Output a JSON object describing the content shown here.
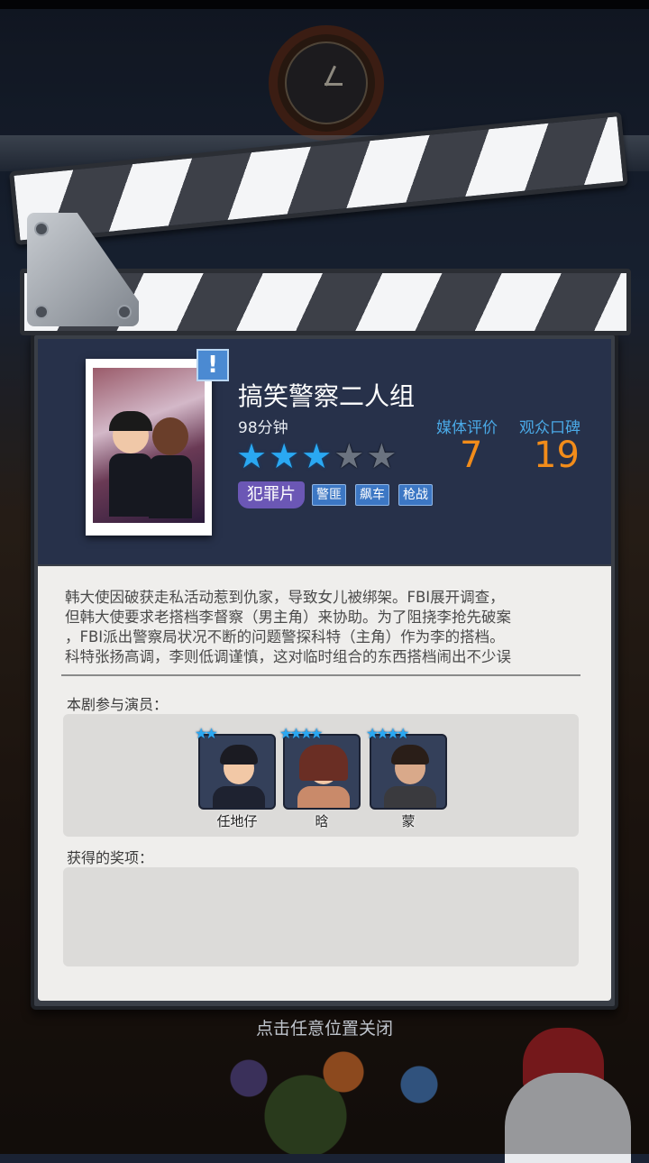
{
  "movie": {
    "title": "搞笑警察二人组",
    "duration": "98分钟",
    "rating_stars": 3,
    "max_stars": 5,
    "genre": "犯罪片",
    "tags": [
      "警匪",
      "飙车",
      "枪战"
    ],
    "media_label": "媒体评价",
    "media_score": "7",
    "audience_label": "观众口碑",
    "audience_score": "19",
    "alert_icon_text": "!",
    "description": [
      "韩大使因破获走私活动惹到仇家，导致女儿被绑架。FBI展开调查，",
      "但韩大使要求老搭档李督察（男主角）来协助。为了阻挠李抢先破案",
      "，FBI派出警察局状况不断的问题警探科特（主角）作为李的搭档。",
      "科特张扬高调，李则低调谨慎，这对临时组合的东西搭档闹出不少误"
    ]
  },
  "cast": {
    "label": "本剧参与演员：",
    "actors": [
      {
        "name": "任地仔",
        "stars": 2
      },
      {
        "name": "晗",
        "stars": 4
      },
      {
        "name": "蒙",
        "stars": 4
      }
    ]
  },
  "awards": {
    "label": "获得的奖项："
  },
  "close_hint": "点击任意位置关闭",
  "colors": {
    "accent_blue": "#2aa8f2",
    "score_orange": "#f28c1a",
    "genre_purple": "#6b57b5"
  }
}
